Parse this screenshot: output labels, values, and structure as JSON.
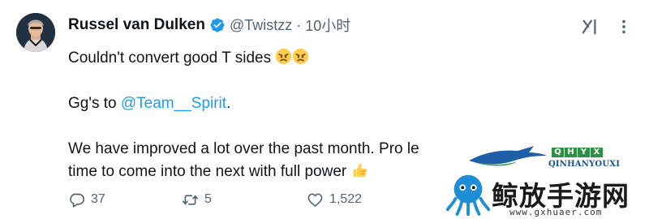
{
  "author": {
    "display_name": "Russel van Dulken",
    "handle": "@Twistzz",
    "separator": "·",
    "timestamp": "10小时",
    "verified": true
  },
  "tweet": {
    "line1": "Couldn't convert good T sides",
    "line2_prefix": "Gg's to ",
    "line2_mention": "@Team__Spirit",
    "line2_suffix": ".",
    "line3a": "We have improved a lot over the past month. Pro le",
    "line3b": "time to come into the next with full power",
    "emojis": [
      "angry-face",
      "angry-face",
      "thumbs-up"
    ]
  },
  "actions": {
    "replies": "37",
    "retweets": "5",
    "likes": "1,522"
  },
  "icons": [
    "verified-badge-icon",
    "grok-icon",
    "more-icon",
    "reply-icon",
    "retweet-icon",
    "like-icon"
  ],
  "watermark": {
    "logo_letters": [
      "Q",
      "H",
      "Y",
      "X"
    ],
    "latin": "QINHANYOUXI",
    "chinese": "鲸放手游网",
    "url": "www.gxhuaer.com"
  },
  "colors": {
    "text": "#0f1419",
    "secondary": "#536471",
    "link": "#1d9bf0",
    "verified": "#1d9bf0"
  }
}
